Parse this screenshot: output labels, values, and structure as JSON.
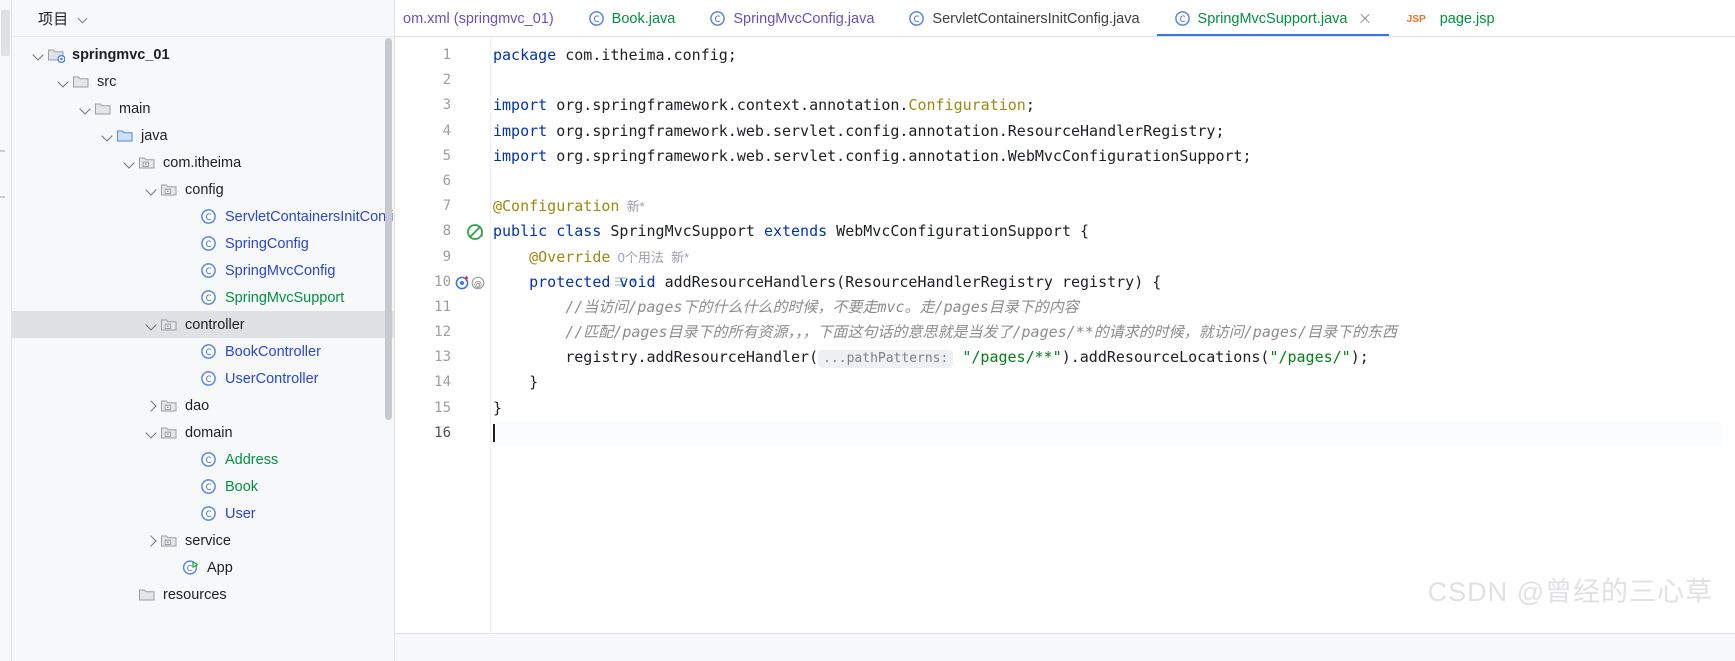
{
  "project_pane": {
    "title": "项目",
    "collapse_icon": "chevron-down-icon",
    "tree": [
      {
        "label": "springmvc_01",
        "indent": 35,
        "twisty": "open",
        "icon": "module-folder-icon",
        "color": "dark",
        "bold": true,
        "selected": false
      },
      {
        "label": "src",
        "indent": 60,
        "twisty": "open",
        "icon": "folder-icon",
        "color": "dark",
        "bold": false,
        "selected": false
      },
      {
        "label": "main",
        "indent": 82,
        "twisty": "open",
        "icon": "folder-icon",
        "color": "dark",
        "bold": false,
        "selected": false
      },
      {
        "label": "java",
        "indent": 104,
        "twisty": "open",
        "icon": "source-folder-icon",
        "color": "dark",
        "bold": false,
        "selected": false
      },
      {
        "label": "com.itheima",
        "indent": 126,
        "twisty": "open",
        "icon": "package-icon",
        "color": "dark",
        "bold": false,
        "selected": false
      },
      {
        "label": "config",
        "indent": 148,
        "twisty": "open",
        "icon": "package-icon",
        "color": "dark",
        "bold": false,
        "selected": false
      },
      {
        "label": "ServletContainersInitConfi",
        "indent": 188,
        "twisty": "none",
        "icon": "java-class-icon",
        "color": "blue",
        "bold": false,
        "selected": false
      },
      {
        "label": "SpringConfig",
        "indent": 188,
        "twisty": "none",
        "icon": "java-class-icon",
        "color": "blue",
        "bold": false,
        "selected": false
      },
      {
        "label": "SpringMvcConfig",
        "indent": 188,
        "twisty": "none",
        "icon": "java-class-icon",
        "color": "blue",
        "bold": false,
        "selected": false
      },
      {
        "label": "SpringMvcSupport",
        "indent": 188,
        "twisty": "none",
        "icon": "java-class-icon",
        "color": "green",
        "bold": false,
        "selected": false
      },
      {
        "label": "controller",
        "indent": 148,
        "twisty": "open",
        "icon": "package-icon",
        "color": "dark",
        "bold": false,
        "selected": true
      },
      {
        "label": "BookController",
        "indent": 188,
        "twisty": "none",
        "icon": "java-class-icon",
        "color": "blue",
        "bold": false,
        "selected": false
      },
      {
        "label": "UserController",
        "indent": 188,
        "twisty": "none",
        "icon": "java-class-icon",
        "color": "blue",
        "bold": false,
        "selected": false
      },
      {
        "label": "dao",
        "indent": 148,
        "twisty": "closed",
        "icon": "package-icon",
        "color": "dark",
        "bold": false,
        "selected": false
      },
      {
        "label": "domain",
        "indent": 148,
        "twisty": "open",
        "icon": "package-icon",
        "color": "dark",
        "bold": false,
        "selected": false
      },
      {
        "label": "Address",
        "indent": 188,
        "twisty": "none",
        "icon": "java-class-icon",
        "color": "green",
        "bold": false,
        "selected": false
      },
      {
        "label": "Book",
        "indent": 188,
        "twisty": "none",
        "icon": "java-class-icon",
        "color": "green",
        "bold": false,
        "selected": false
      },
      {
        "label": "User",
        "indent": 188,
        "twisty": "none",
        "icon": "java-class-icon",
        "color": "blue",
        "bold": false,
        "selected": false
      },
      {
        "label": "service",
        "indent": 148,
        "twisty": "closed",
        "icon": "package-icon",
        "color": "dark",
        "bold": false,
        "selected": false
      },
      {
        "label": "App",
        "indent": 170,
        "twisty": "none",
        "icon": "runnable-class-icon",
        "color": "dark",
        "bold": false,
        "selected": false
      },
      {
        "label": "resources",
        "indent": 126,
        "twisty": "none",
        "icon": "folder-icon",
        "color": "dark",
        "bold": false,
        "selected": false
      }
    ]
  },
  "editor": {
    "tabs": [
      {
        "label": "om.xml (springmvc_01)",
        "icon": "xml-file-icon",
        "color": "#6e4fb5",
        "active": false,
        "closable": false
      },
      {
        "label": "Book.java",
        "icon": "java-class-icon",
        "color": "#00923f",
        "active": false,
        "closable": false
      },
      {
        "label": "SpringMvcConfig.java",
        "icon": "java-class-icon",
        "color": "#6e4fb5",
        "active": false,
        "closable": false
      },
      {
        "label": "ServletContainersInitConfig.java",
        "icon": "java-class-icon",
        "color": "#3c4043",
        "active": false,
        "closable": false
      },
      {
        "label": "SpringMvcSupport.java",
        "icon": "java-class-icon",
        "color": "#00923f",
        "active": true,
        "closable": true
      },
      {
        "label": "page.jsp",
        "icon": "jsp-file-icon",
        "color": "#00923f",
        "active": false,
        "closable": false
      }
    ],
    "line_numbers": [
      "1",
      "2",
      "3",
      "4",
      "5",
      "6",
      "7",
      "8",
      "9",
      "10",
      "11",
      "12",
      "13",
      "14",
      "15",
      "16"
    ],
    "current_line": "16",
    "gutter_icons": {
      "line8": "spring-bean-icon",
      "line10": "override-method-icon"
    },
    "lines": [
      {
        "n": "1",
        "tokens": [
          {
            "t": "kw",
            "v": "package"
          },
          {
            "t": "plain",
            "v": " com.itheima.config;"
          }
        ]
      },
      {
        "n": "2",
        "tokens": []
      },
      {
        "n": "3",
        "tokens": [
          {
            "t": "kw",
            "v": "import"
          },
          {
            "t": "plain",
            "v": " org.springframework.context.annotation."
          },
          {
            "t": "ann",
            "v": "Configuration"
          },
          {
            "t": "plain",
            "v": ";"
          }
        ]
      },
      {
        "n": "4",
        "tokens": [
          {
            "t": "kw",
            "v": "import"
          },
          {
            "t": "plain",
            "v": " org.springframework.web.servlet.config.annotation.ResourceHandlerRegistry;"
          }
        ]
      },
      {
        "n": "5",
        "tokens": [
          {
            "t": "kw",
            "v": "import"
          },
          {
            "t": "plain",
            "v": " org.springframework.web.servlet.config.annotation.WebMvcConfigurationSupport;"
          }
        ]
      },
      {
        "n": "6",
        "tokens": []
      },
      {
        "n": "7",
        "tokens": [
          {
            "t": "ann",
            "v": "@Configuration"
          },
          {
            "t": "inlay",
            "v": "  新*"
          }
        ]
      },
      {
        "n": "8",
        "tokens": [
          {
            "t": "kw",
            "v": "public class"
          },
          {
            "t": "plain",
            "v": " SpringMvcSupport "
          },
          {
            "t": "kw",
            "v": "extends"
          },
          {
            "t": "plain",
            "v": " WebMvcConfigurationSupport {"
          }
        ]
      },
      {
        "n": "9",
        "tokens": [
          {
            "t": "plain",
            "v": "    "
          },
          {
            "t": "ann",
            "v": "@Override"
          },
          {
            "t": "inlay",
            "v": "  0个用法  新*"
          }
        ]
      },
      {
        "n": "10",
        "tokens": [
          {
            "t": "plain",
            "v": "    "
          },
          {
            "t": "kw",
            "v": "protected void"
          },
          {
            "t": "plain",
            "v": " addResourceHandlers(ResourceHandlerRegistry registry) {"
          }
        ]
      },
      {
        "n": "11",
        "tokens": [
          {
            "t": "plain",
            "v": "        "
          },
          {
            "t": "cmt",
            "v": "//当访问/pages下的什么什么的时候，不要走mvc。走/pages目录下的内容"
          }
        ]
      },
      {
        "n": "12",
        "tokens": [
          {
            "t": "plain",
            "v": "        "
          },
          {
            "t": "cmt",
            "v": "//匹配/pages目录下的所有资源，，，下面这句话的意思就是当发了/pages/**的请求的时候，就访问/pages/目录下的东西"
          }
        ]
      },
      {
        "n": "13",
        "tokens": [
          {
            "t": "plain",
            "v": "        registry.addResourceHandler("
          },
          {
            "t": "hint",
            "v": "...pathPatterns:"
          },
          {
            "t": "str",
            "v": " \"/pages/**\""
          },
          {
            "t": "plain",
            "v": ").addResourceLocations("
          },
          {
            "t": "str",
            "v": "\"/pages/\""
          },
          {
            "t": "plain",
            "v": ");"
          }
        ]
      },
      {
        "n": "14",
        "tokens": [
          {
            "t": "plain",
            "v": "    }"
          }
        ]
      },
      {
        "n": "15",
        "tokens": [
          {
            "t": "plain",
            "v": "}"
          }
        ]
      },
      {
        "n": "16",
        "tokens": [
          {
            "t": "caret",
            "v": ""
          }
        ]
      }
    ],
    "fold_widget": "fold-indicator"
  },
  "watermark": "CSDN @曾经的三心草"
}
